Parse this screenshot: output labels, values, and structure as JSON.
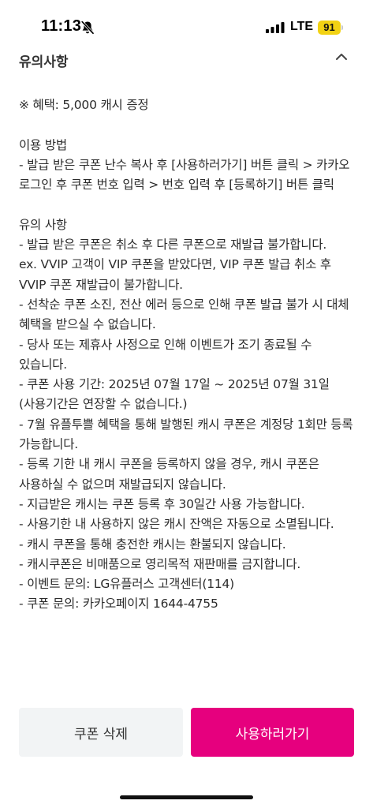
{
  "status_bar": {
    "time": "11:13",
    "network": "LTE",
    "battery": "91"
  },
  "header": {
    "title": "유의사항"
  },
  "content": {
    "benefit": "※ 혜택: 5,000 캐시 증정",
    "usage_title": "이용 방법",
    "usage_line": "- 발급 받은 쿠폰 난수 복사 후 [사용하러가기] 버튼 클릭 > 카카오 로그인 후 쿠폰 번호 입력 > 번호 입력 후 [등록하기] 버튼 클릭",
    "notice_title": "유의 사항",
    "notices": [
      "- 발급 받은 쿠폰은 취소 후 다른 쿠폰으로 재발급 불가합니다.",
      "ex. VVIP 고객이 VIP 쿠폰을 받았다면, VIP 쿠폰 발급 취소 후 VVIP 쿠폰 재발급이 불가합니다.",
      "- 선착순 쿠폰 소진, 전산 에러 등으로 인해 쿠폰 발급 불가 시 대체 혜택을 받으실 수 없습니다.",
      "- 당사 또는 제휴사 사정으로 인해 이벤트가 조기 종료될 수 있습니다.",
      "- 쿠폰 사용 기간: 2025년 07월 17일 ~ 2025년 07월 31일 (사용기간은 연장할 수 없습니다.)",
      "- 7월 유플투쁠 혜택을 통해 발행된 캐시 쿠폰은 계정당 1회만 등록 가능합니다.",
      "- 등록 기한 내 캐시 쿠폰을 등록하지 않을 경우, 캐시 쿠폰은 사용하실 수 없으며 재발급되지 않습니다.",
      "- 지급받은 캐시는 쿠폰 등록 후 30일간 사용 가능합니다.",
      "- 사용기한 내 사용하지 않은 캐시 잔액은 자동으로 소멸됩니다.",
      "- 캐시 쿠폰을 통해 충전한 캐시는 환불되지 않습니다.",
      "- 캐시쿠폰은 비매품으로 영리목적 재판매를 금지합니다.",
      "- 이벤트 문의: LG유플러스 고객센터(114)",
      "- 쿠폰 문의: 카카오페이지 1644-4755"
    ]
  },
  "buttons": {
    "delete_label": "쿠폰 삭제",
    "go_label": "사용하러가기"
  },
  "colors": {
    "accent": "#e6007e",
    "secondary_button": "#f2f4f5",
    "battery": "#f2d214"
  },
  "icons": {
    "bell": "bell-slash-icon",
    "signal": "cellular-signal-icon",
    "chevron": "chevron-up-icon"
  }
}
